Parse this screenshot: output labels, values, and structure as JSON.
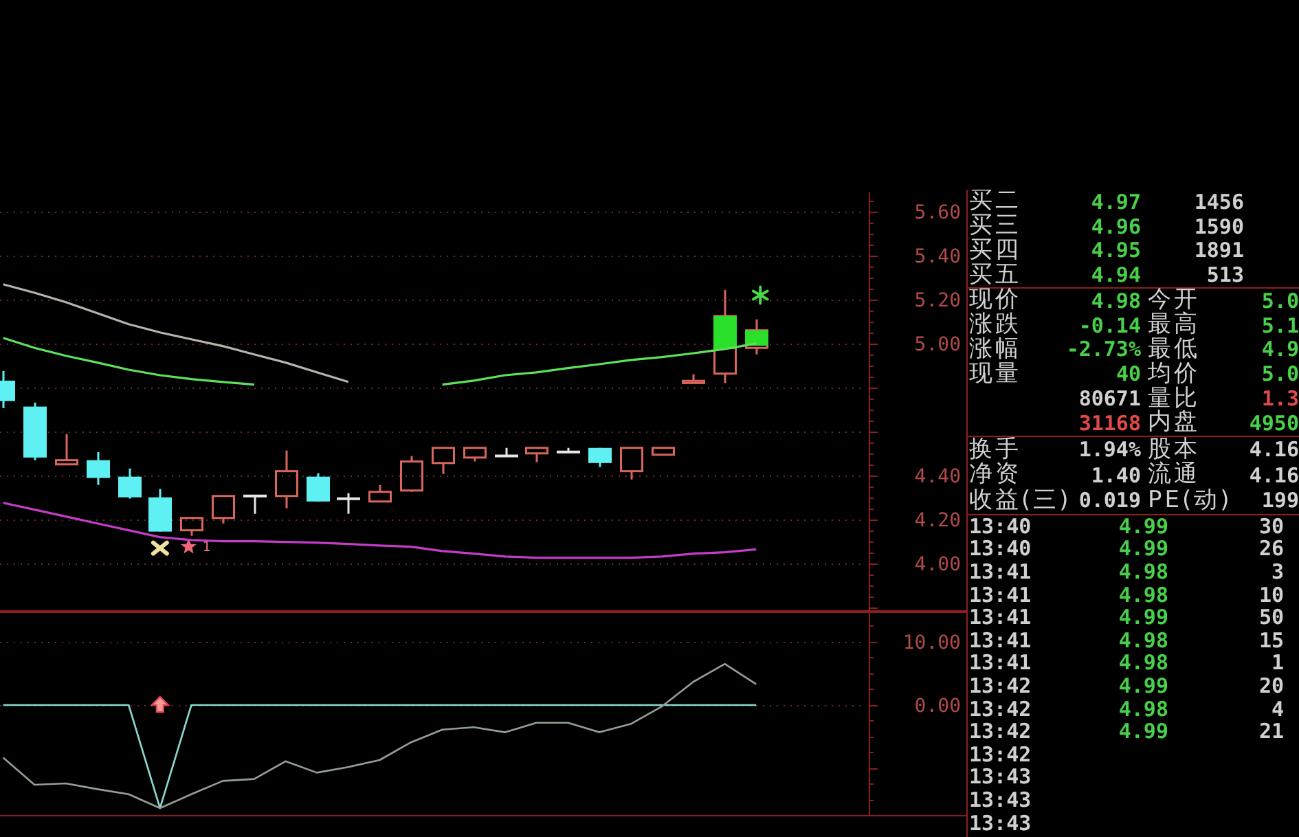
{
  "price_chart": {
    "marker_text": "1",
    "chart_data": {
      "type": "line",
      "ylim": [
        3.78,
        5.7
      ],
      "grid": true,
      "yticks": [
        {
          "value": 5.6,
          "label": "5.60"
        },
        {
          "value": 5.4,
          "label": "5.40"
        },
        {
          "value": 5.2,
          "label": "5.20"
        },
        {
          "value": 5.0,
          "label": "5.00"
        },
        {
          "value": 4.4,
          "label": "4.40"
        },
        {
          "value": 4.2,
          "label": "4.20"
        },
        {
          "value": 4.0,
          "label": "4.00"
        }
      ],
      "series": [
        {
          "color": "#b4b4ac",
          "values": [
            5.269,
            5.231,
            5.188,
            5.138,
            5.088,
            5.05,
            5.019,
            4.988,
            4.95,
            4.913,
            4.869,
            4.825,
            null,
            null,
            null,
            null,
            null,
            null,
            null,
            null,
            null,
            null,
            null,
            null,
            null
          ]
        },
        {
          "color": "#5ee05a",
          "values": [
            5.025,
            4.98,
            4.944,
            4.913,
            4.881,
            4.856,
            4.838,
            4.825,
            4.813,
            null,
            null,
            null,
            null,
            null,
            4.813,
            4.831,
            4.856,
            4.869,
            4.888,
            4.906,
            4.925,
            4.938,
            4.956,
            4.975,
            5.0
          ]
        },
        {
          "color": "#c43cc8",
          "values": [
            4.275,
            4.244,
            4.213,
            4.181,
            4.15,
            4.119,
            4.106,
            4.1,
            4.1,
            4.097,
            4.094,
            4.088,
            4.081,
            4.075,
            4.056,
            4.044,
            4.031,
            4.025,
            4.025,
            4.025,
            4.025,
            4.031,
            4.044,
            4.05,
            4.063
          ]
        }
      ]
    }
  },
  "indicator_chart": {
    "chart_data": {
      "type": "line",
      "ylim": [
        -17.61,
        14.78
      ],
      "grid": true,
      "yticks": [
        {
          "value": 10,
          "label": "10.00"
        },
        {
          "value": 0,
          "label": "0.00"
        }
      ],
      "series": [
        {
          "color": "#8ad8d0",
          "values": [
            0,
            0,
            0,
            0,
            0,
            -16.3,
            0,
            0,
            0,
            0,
            0,
            0,
            0,
            0,
            0,
            0,
            0,
            0,
            0,
            0,
            0,
            0,
            0,
            0,
            0
          ]
        },
        {
          "color": "#94a094",
          "values": [
            -8.3,
            -12.6,
            -12.4,
            -13.3,
            -14.1,
            -16.3,
            -14.1,
            -12.0,
            -11.7,
            -8.9,
            -10.7,
            -9.8,
            -8.7,
            -5.9,
            -3.9,
            -3.5,
            -4.3,
            -2.8,
            -2.8,
            -4.3,
            -3.0,
            -0.2,
            3.7,
            6.5,
            3.3
          ]
        }
      ]
    }
  },
  "quote_panel": {
    "order_book": [
      {
        "label": "买二",
        "price": "4.97",
        "volume": "1456"
      },
      {
        "label": "买三",
        "price": "4.96",
        "volume": "1590"
      },
      {
        "label": "买四",
        "price": "4.95",
        "volume": "1891"
      },
      {
        "label": "买五",
        "price": "4.94",
        "volume": "513"
      }
    ],
    "market_stats": [
      [
        {
          "label": "现价",
          "value": "4.98",
          "color": "#48d048"
        },
        {
          "label": "今开",
          "value": "5.0",
          "color": "#48d048"
        }
      ],
      [
        {
          "label": "涨跌",
          "value": "-0.14",
          "color": "#48d048"
        },
        {
          "label": "最高",
          "value": "5.1",
          "color": "#48d048"
        }
      ],
      [
        {
          "label": "涨幅",
          "value": "-2.73%",
          "color": "#48d048"
        },
        {
          "label": "最低",
          "value": "4.9",
          "color": "#48d048"
        }
      ],
      [
        {
          "label": "现量",
          "value": "40",
          "color": "#48d048"
        },
        {
          "label": "均价",
          "value": "5.0",
          "color": "#48d048"
        }
      ],
      [
        {
          "value": "80671",
          "color": "#d0d0d0"
        },
        {
          "label": "量比",
          "value": "1.3",
          "color": "#e04a4a"
        }
      ],
      [
        {
          "value": "31168",
          "color": "#e04a4a"
        },
        {
          "label": "内盘",
          "value": "4950",
          "color": "#48d048"
        }
      ]
    ],
    "share_stats": [
      [
        {
          "label": "换手",
          "value": "1.94%",
          "color": "#d0d0d0"
        },
        {
          "label": "股本",
          "value": "4.16",
          "color": "#d0d0d0"
        }
      ],
      [
        {
          "label": "净资",
          "value": "1.40",
          "color": "#d0d0d0"
        },
        {
          "label": "流通",
          "value": "4.16",
          "color": "#d0d0d0"
        }
      ],
      [
        {
          "label": "收益(三)",
          "value": "0.019",
          "color": "#d0d0d0"
        },
        {
          "label": "PE(动)",
          "value": "199",
          "color": "#d0d0d0"
        }
      ]
    ],
    "trades": [
      {
        "time": "13:40",
        "price": "4.99",
        "volume": "30"
      },
      {
        "time": "13:40",
        "price": "4.99",
        "volume": "26"
      },
      {
        "time": "13:41",
        "price": "4.98",
        "volume": "3"
      },
      {
        "time": "13:41",
        "price": "4.98",
        "volume": "10"
      },
      {
        "time": "13:41",
        "price": "4.99",
        "volume": "50"
      },
      {
        "time": "13:41",
        "price": "4.98",
        "volume": "15"
      },
      {
        "time": "13:41",
        "price": "4.98",
        "volume": "1"
      },
      {
        "time": "13:42",
        "price": "4.99",
        "volume": "20"
      },
      {
        "time": "13:42",
        "price": "4.98",
        "volume": "4"
      },
      {
        "time": "13:42",
        "price": "4.99",
        "volume": "21"
      },
      {
        "time": "13:42"
      },
      {
        "time": "13:43"
      },
      {
        "time": "13:43"
      },
      {
        "time": "13:43"
      }
    ]
  }
}
